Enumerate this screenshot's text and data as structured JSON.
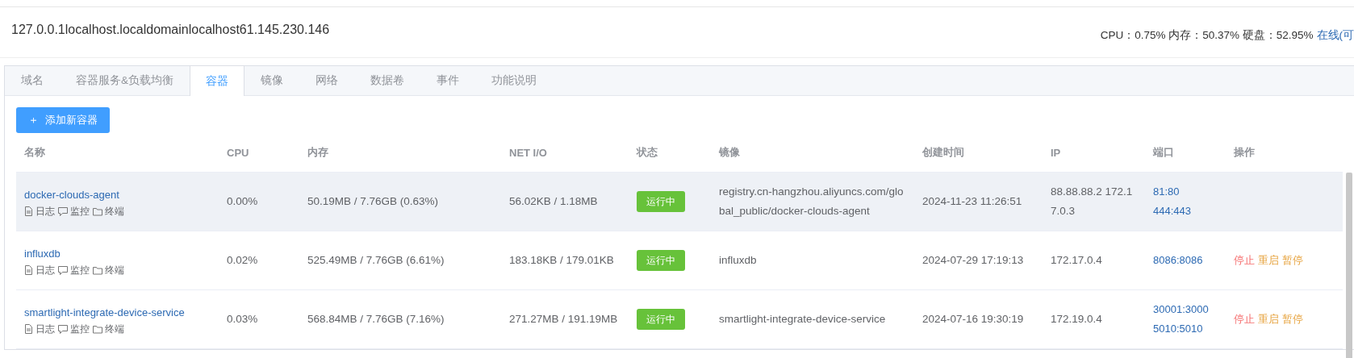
{
  "host": {
    "title": "127.0.0.1localhost.localdomainlocalhost61.145.230.146",
    "stats": "CPU：0.75% 内存：50.37% 硬盘：52.95%",
    "status_link": "在线(可"
  },
  "tabs": [
    {
      "label": "域名",
      "selected": false
    },
    {
      "label": "容器服务&负载均衡",
      "selected": false
    },
    {
      "label": "容器",
      "selected": true
    },
    {
      "label": "镜像",
      "selected": false
    },
    {
      "label": "网络",
      "selected": false
    },
    {
      "label": "数据卷",
      "selected": false
    },
    {
      "label": "事件",
      "selected": false
    },
    {
      "label": "功能说明",
      "selected": false
    }
  ],
  "add_button": {
    "icon": "＋",
    "label": "添加新容器"
  },
  "table": {
    "columns": [
      "名称",
      "CPU",
      "内存",
      "NET I/O",
      "状态",
      "镜像",
      "创建时间",
      "IP",
      "端口",
      "操作"
    ],
    "rows": [
      {
        "name": "docker-clouds-agent",
        "links": [
          "日志",
          "监控",
          "终端"
        ],
        "cpu": "0.00%",
        "memory": "50.19MB / 7.76GB (0.63%)",
        "net_io": "56.02KB / 1.18MB",
        "status": "运行中",
        "image": "registry.cn-hangzhou.aliyuncs.com/global_public/docker-clouds-agent",
        "created": "2024-11-23 11:26:51",
        "ip": "88.88.88.2 172.17.0.3",
        "ports": [
          "81:80",
          "444:443"
        ],
        "actions": [],
        "highlighted": true
      },
      {
        "name": "influxdb",
        "links": [
          "日志",
          "监控",
          "终端"
        ],
        "cpu": "0.02%",
        "memory": "525.49MB / 7.76GB (6.61%)",
        "net_io": "183.18KB / 179.01KB",
        "status": "运行中",
        "image": "influxdb",
        "created": "2024-07-29 17:19:13",
        "ip": "172.17.0.4",
        "ports": [
          "8086:8086"
        ],
        "actions": [
          {
            "label": "停止",
            "kind": "stop"
          },
          {
            "label": "重启",
            "kind": "restart"
          },
          {
            "label": "暂停",
            "kind": "pause"
          }
        ],
        "highlighted": false
      },
      {
        "name": "smartlight-integrate-device-service",
        "links": [
          "日志",
          "监控",
          "终端"
        ],
        "cpu": "0.03%",
        "memory": "568.84MB / 7.76GB (7.16%)",
        "net_io": "271.27MB / 191.19MB",
        "status": "运行中",
        "image": "smartlight-integrate-device-service",
        "created": "2024-07-16 19:30:19",
        "ip": "172.19.0.4",
        "ports": [
          "30001:3000",
          "5010:5010"
        ],
        "actions": [
          {
            "label": "停止",
            "kind": "stop"
          },
          {
            "label": "重启",
            "kind": "restart"
          },
          {
            "label": "暂停",
            "kind": "pause"
          }
        ],
        "highlighted": false
      }
    ]
  }
}
